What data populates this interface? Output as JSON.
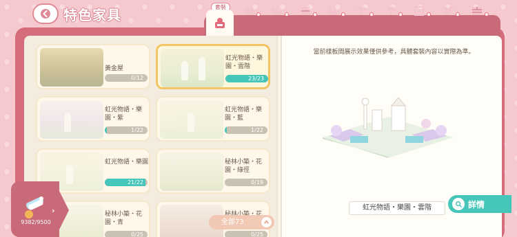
{
  "header": {
    "title": "特色家具",
    "active_tab_label": "套裝"
  },
  "tabs": [
    {
      "name": "set-tab",
      "active": true
    },
    {
      "name": "sofa-tab",
      "active": false
    },
    {
      "name": "bed-tab",
      "active": false
    },
    {
      "name": "cabinet-tab",
      "active": false
    },
    {
      "name": "bathtub-tab",
      "active": false
    },
    {
      "name": "table-tab",
      "active": false
    },
    {
      "name": "lamp-tab",
      "active": false
    },
    {
      "name": "bear-toy-tab",
      "active": false
    },
    {
      "name": "wall-tab",
      "active": false
    }
  ],
  "cards": [
    {
      "name": "黃金屋",
      "progress": "0/12",
      "fill": 0
    },
    {
      "name": "虹光物語・樂園・雲階",
      "progress": "23/23",
      "fill": 1.0,
      "selected": true
    },
    {
      "name": "虹光物語・樂園・紫",
      "progress": "1/22",
      "fill": 0.045
    },
    {
      "name": "虹光物語・樂園・藍",
      "progress": "1/22",
      "fill": 0.045
    },
    {
      "name": "虹光物語・樂園",
      "progress": "21/22",
      "fill": 0.955
    },
    {
      "name": "秘林小築・花園・綠徑",
      "progress": "0/19",
      "fill": 0
    },
    {
      "name": "秘林小築・花園・青",
      "progress": "0/25",
      "fill": 0
    },
    {
      "name": "秘林小築・花",
      "progress": "0/25",
      "fill": 0
    }
  ],
  "filter": {
    "label": "全部73"
  },
  "detail": {
    "notice": "當前樣板間展示效果僅供參考，具體套裝內容以實際為準。",
    "set_name": "虹光物語・樂園・雲階",
    "details_button": "詳情"
  },
  "points": {
    "value": "9382/9500"
  },
  "colors": {
    "accent": "#46c6b8",
    "brand": "#d56c7c",
    "selected_border": "#f2c463"
  }
}
